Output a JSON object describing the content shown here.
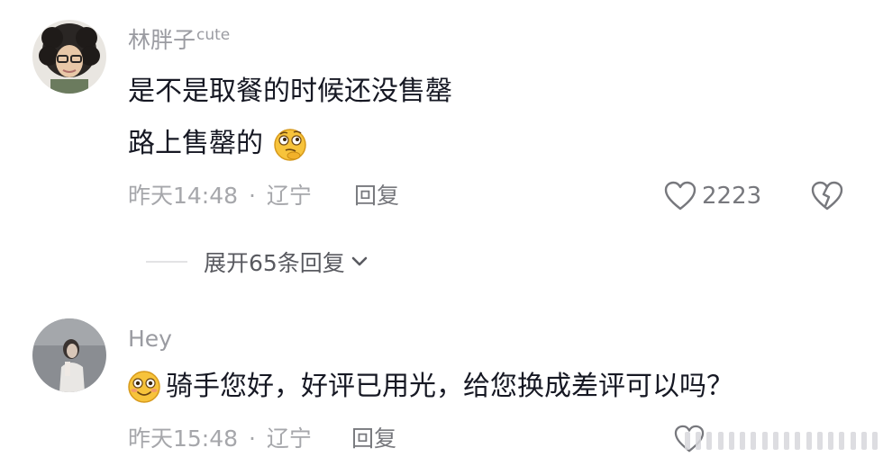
{
  "comments": [
    {
      "username": "林胖子",
      "username_suffix": "cute",
      "lines": [
        "是不是取餐的时候还没售罄",
        "路上售罄的"
      ],
      "timestamp": "昨天14:48",
      "separator": "·",
      "location": "辽宁",
      "reply_label": "回复",
      "like_count": "2223",
      "expand_label": "展开65条回复",
      "emoji": "thinking-face-emoji"
    },
    {
      "username": "Hey",
      "lines": [
        "骑手您好，好评已用光，给您换成差评可以吗？"
      ],
      "timestamp": "昨天15:48",
      "separator": "·",
      "location": "辽宁",
      "reply_label": "回复",
      "emoji": "smiling-face-emoji"
    }
  ],
  "icons": {
    "like": "heart-outline-icon",
    "dislike": "broken-heart-icon",
    "expand": "chevron-down-icon"
  },
  "colors": {
    "text_primary": "#161823",
    "text_secondary": "#9a9ba1",
    "text_action": "#77787d"
  }
}
